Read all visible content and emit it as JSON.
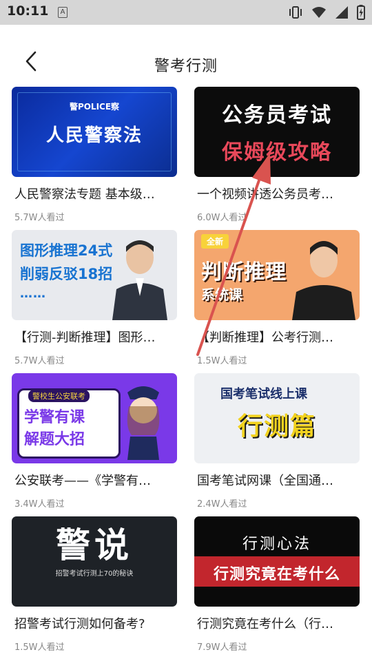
{
  "status_bar": {
    "time": "10:11",
    "notification_glyph": "A",
    "icons": [
      "vibrate-icon",
      "wifi-icon",
      "signal-icon",
      "battery-icon"
    ]
  },
  "header": {
    "title": "警考行测",
    "back_icon": "chevron-left-icon"
  },
  "courses": [
    {
      "title": "人民警察法专题 基本级…",
      "views": "5.7W人看过",
      "thumb": {
        "badge": "警POLICE察",
        "line1": "人民警察法"
      }
    },
    {
      "title": "一个视频讲透公务员考…",
      "views": "6.0W人看过",
      "thumb": {
        "line1": "公务员考试",
        "line2": "保姆级攻略"
      }
    },
    {
      "title": "【行测-判断推理】图形…",
      "views": "5.7W人看过",
      "thumb": {
        "line1": "图形推理24式",
        "line2": "削弱反驳18招",
        "line3": "……"
      }
    },
    {
      "title": "【判断推理】公考行测…",
      "views": "1.5W人看过",
      "thumb": {
        "tag": "全新",
        "line1": "判断推理",
        "line2": "系统课"
      }
    },
    {
      "title": "公安联考——《学警有…",
      "views": "3.4W人看过",
      "thumb": {
        "top": "警校生公安联考",
        "line1": "学警有课",
        "line2": "解题大招"
      }
    },
    {
      "title": "国考笔试网课（全国通…",
      "views": "2.4W人看过",
      "thumb": {
        "line1": "国考笔试线上课",
        "line2": "行测篇"
      }
    },
    {
      "title": "招警考试行测如何备考?",
      "views": "1.5W人看过",
      "thumb": {
        "line1": "警说",
        "line2": "招警考试行测上70的秘诀"
      }
    },
    {
      "title": "行测究竟在考什么（行…",
      "views": "7.9W人看过",
      "thumb": {
        "line1": "行测心法",
        "line2": "行测究竟在考什么"
      }
    }
  ],
  "colors": {
    "status_bar_bg": "#d6d6d6",
    "title_text": "#222222",
    "views_text": "#888888",
    "annotation_arrow": "#d9534f"
  }
}
